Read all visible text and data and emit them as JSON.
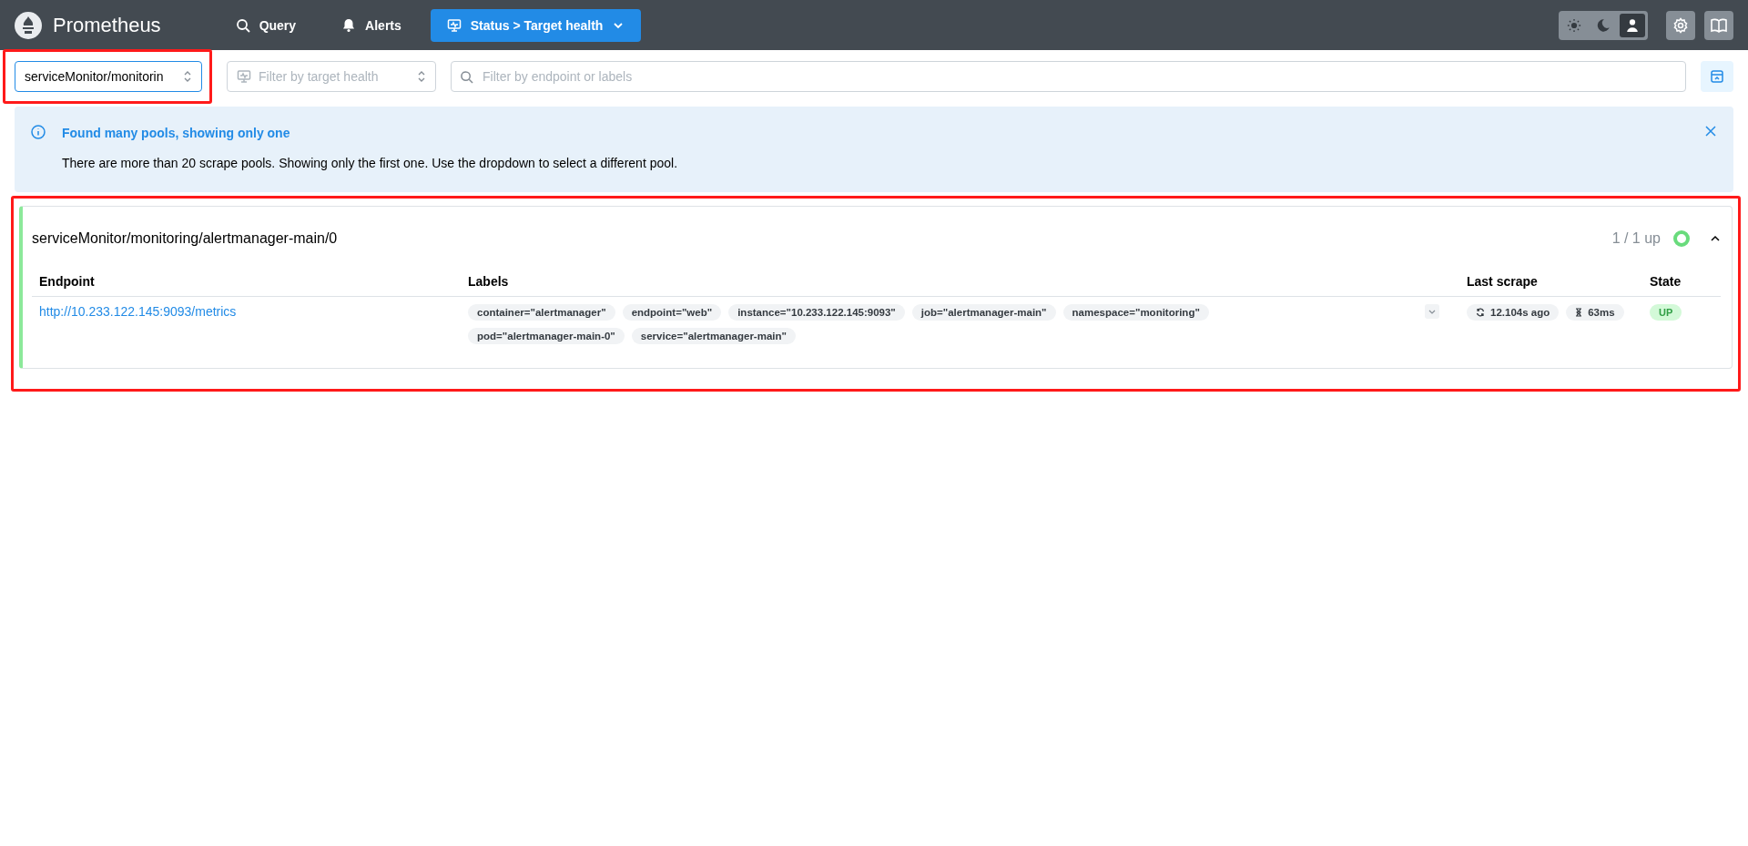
{
  "header": {
    "brand": "Prometheus",
    "nav": [
      {
        "label": "Query",
        "selected": false
      },
      {
        "label": "Alerts",
        "selected": false
      },
      {
        "label": "Status > Target health",
        "selected": true
      }
    ],
    "theme_modes": [
      {
        "kind": "light",
        "selected": false
      },
      {
        "kind": "dark",
        "selected": false
      },
      {
        "kind": "auto",
        "selected": true
      }
    ]
  },
  "filters": {
    "pool_select": {
      "value": "serviceMonitor/monitorin"
    },
    "health_select": {
      "placeholder": "Filter by target health"
    },
    "search": {
      "placeholder": "Filter by endpoint or labels"
    }
  },
  "alert": {
    "title": "Found many pools, showing only one",
    "message": "There are more than 20 scrape pools. Showing only the first one. Use the dropdown to select a different pool."
  },
  "pool": {
    "name": "serviceMonitor/monitoring/alertmanager-main/0",
    "summary": "1 / 1 up",
    "expanded": true,
    "table": {
      "columns": [
        "Endpoint",
        "Labels",
        "Last scrape",
        "State"
      ],
      "rows": [
        {
          "endpoint": "http://10.233.122.145:9093/metrics",
          "labels": [
            "container=\"alertmanager\"",
            "endpoint=\"web\"",
            "instance=\"10.233.122.145:9093\"",
            "job=\"alertmanager-main\"",
            "namespace=\"monitoring\"",
            "pod=\"alertmanager-main-0\"",
            "service=\"alertmanager-main\""
          ],
          "last_scrape": "12.104s ago",
          "duration": "63ms",
          "state": "UP"
        }
      ]
    }
  }
}
